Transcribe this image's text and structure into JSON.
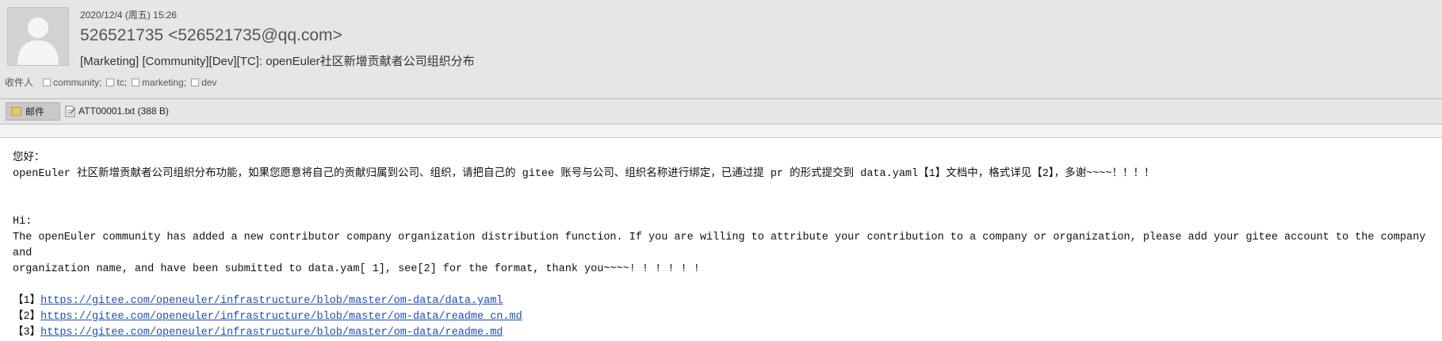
{
  "header": {
    "date": "2020/12/4 (周五) 15:26",
    "sender": "526521735 <526521735@qq.com>",
    "subject": "[Marketing] [Community][Dev][TC]: openEuler社区新增贡献者公司组织分布",
    "to_label": "收件人",
    "recipients": [
      "community;",
      "tc;",
      "marketing;",
      "dev"
    ]
  },
  "attachments_bar": {
    "mail_tab_label": "邮件",
    "attachment_name": "ATT00001.txt (388 B)"
  },
  "body": {
    "greeting_cn": "您好：",
    "para_cn": "openEuler 社区新增贡献者公司组织分布功能，如果您愿意将自己的贡献归属到公司、组织，请把自己的 gitee 账号与公司、组织名称进行绑定，已通过提 pr 的形式提交到 data.yaml【1】文档中，格式详见【2】，多谢~~~~！！！！",
    "greeting_en": "Hi:",
    "para_en_1": "The openEuler community has added a new contributor company organization distribution function. If you are willing to attribute your contribution to a company or organization, please add your gitee account to the company and",
    "para_en_2": "organization name, and have been submitted to data.yam[ 1], see[2] for the format, thank you~~~~! ! ! ! ! !",
    "refs": [
      {
        "label": "【1】",
        "url": "https://gitee.com/openeuler/infrastructure/blob/master/om-data/data.yaml"
      },
      {
        "label": "【2】",
        "url": "https://gitee.com/openeuler/infrastructure/blob/master/om-data/readme_cn.md"
      },
      {
        "label": "【3】",
        "url": "https://gitee.com/openeuler/infrastructure/blob/master/om-data/readme.md"
      }
    ]
  },
  "icons": {
    "avatar": "default-user-avatar",
    "mail_tab": "envelope-icon",
    "attachment": "text-file-icon",
    "recipient_marker": "checkbox-icon"
  },
  "colors": {
    "header_bg": "#e6e6e6",
    "link": "#1f4db3"
  }
}
